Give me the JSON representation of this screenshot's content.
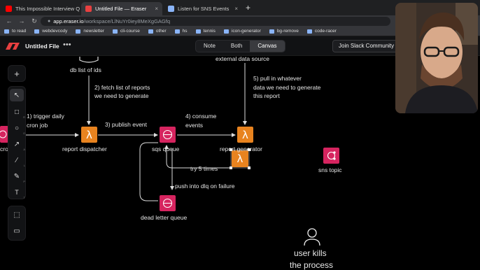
{
  "browser": {
    "tabs": [
      {
        "title": "This Impossible Interview Que",
        "favicon_color": "#ff0000"
      },
      {
        "title": "Untitled File — Eraser",
        "favicon_color": "#e84040",
        "active": true
      },
      {
        "title": "Listen for SNS Events",
        "favicon_color": "#8ab4f8"
      }
    ],
    "new_tab": "+",
    "close_glyph": "×",
    "url_host": "app.eraser.io",
    "url_path": "/workspace/LlNuYr0iey8MeXgGAGfq",
    "bookmarks": [
      "to read",
      "webdevcody",
      "newsletter",
      "cli-course",
      "other",
      "hs",
      "tennis",
      "icon-generator",
      "bg-remove",
      "code-racer"
    ]
  },
  "app": {
    "file_name": "Untitled File",
    "more_glyph": "•••",
    "view_modes": [
      "Note",
      "Both",
      "Canvas"
    ],
    "active_view": "Canvas",
    "slack_button": "Join Slack Community"
  },
  "toolbar": {
    "top": [
      {
        "icon": "plus-icon",
        "glyph": "+"
      }
    ],
    "main": [
      {
        "icon": "pointer-icon",
        "glyph": "↖",
        "key": "",
        "active": true
      },
      {
        "icon": "rectangle-icon",
        "glyph": "□",
        "key": "R"
      },
      {
        "icon": "circle-icon",
        "glyph": "○",
        "key": "O"
      },
      {
        "icon": "arrow-icon",
        "glyph": "↗",
        "key": "A"
      },
      {
        "icon": "line-icon",
        "glyph": "∕",
        "key": "L"
      },
      {
        "icon": "pen-icon",
        "glyph": "✎",
        "key": "P"
      },
      {
        "icon": "text-icon",
        "glyph": "T",
        "key": "T"
      }
    ],
    "bottom": [
      {
        "icon": "frame-icon",
        "glyph": "⬚"
      },
      {
        "icon": "comment-icon",
        "glyph": "▭"
      }
    ]
  },
  "diagram": {
    "labels": {
      "db": "db list of ids",
      "fetch_1": "2) fetch list of reports",
      "fetch_2": "we need to generate",
      "trigger_1": "1) trigger daily",
      "trigger_2": "cron job",
      "publish": "3) publish event",
      "consume_1": "4) consume",
      "consume_2": "events",
      "external": "external data source",
      "pull_1": "5) pull in whatever",
      "pull_2": "data we need to generate",
      "pull_3": "this report",
      "cron": "cro",
      "dispatcher": "report dispatcher",
      "sqs": "sqs queue",
      "generator": "report generator",
      "try5": "try 5 times",
      "dlq_push": "push into dlq on failure",
      "dlq": "dead letter queue",
      "sns": "sns topic",
      "kills_1": "user kills",
      "kills_2": "the process"
    },
    "colors": {
      "lambda": "#e8831f",
      "sqs": "#d6245f",
      "line": "#dcdcdc"
    }
  }
}
